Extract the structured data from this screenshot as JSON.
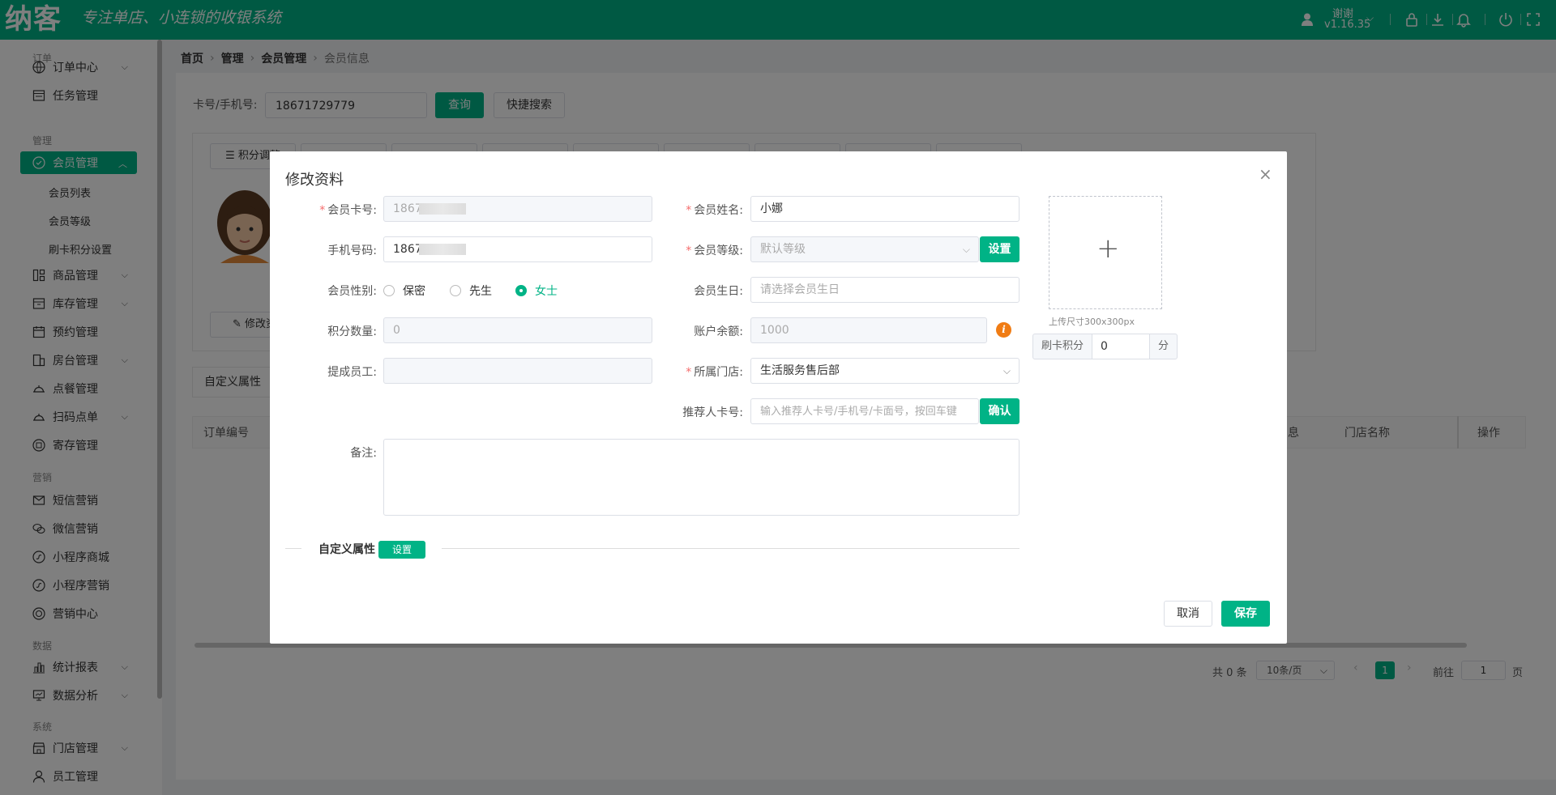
{
  "header": {
    "logo": "纳客",
    "slogan": "专注单店、小连锁的收银系统",
    "user_name": "谢谢",
    "version": "v1.16.35"
  },
  "sidebar": {
    "sections": [
      "订单",
      "管理",
      "营销",
      "数据",
      "系统"
    ],
    "items": [
      {
        "label": "订单中心"
      },
      {
        "label": "任务管理"
      },
      {
        "label": "会员管理"
      },
      {
        "label": "会员列表"
      },
      {
        "label": "会员等级"
      },
      {
        "label": "刷卡积分设置"
      },
      {
        "label": "商品管理"
      },
      {
        "label": "库存管理"
      },
      {
        "label": "预约管理"
      },
      {
        "label": "房台管理"
      },
      {
        "label": "点餐管理"
      },
      {
        "label": "扫码点单"
      },
      {
        "label": "寄存管理"
      },
      {
        "label": "短信营销"
      },
      {
        "label": "微信营销"
      },
      {
        "label": "小程序商城"
      },
      {
        "label": "小程序营销"
      },
      {
        "label": "营销中心"
      },
      {
        "label": "统计报表"
      },
      {
        "label": "数据分析"
      },
      {
        "label": "门店管理"
      },
      {
        "label": "员工管理"
      }
    ]
  },
  "breadcrumb": [
    "首页",
    "管理",
    "会员管理",
    "会员信息"
  ],
  "search": {
    "label": "卡号/手机号:",
    "value": "18671729779",
    "query_btn": "查询",
    "quick_btn": "快捷搜索"
  },
  "page": {
    "tab_first": "积分调整",
    "edit_btn": "修改资",
    "custom_tab": "自定义属性",
    "col_order_no": "订单编号",
    "col_info": "息",
    "col_store": "门店名称",
    "col_op": "操作",
    "pagination": {
      "total": "共 0 条",
      "page_size": "10条/页",
      "current": "1",
      "goto_label": "前往",
      "goto_value": "1",
      "page_unit": "页"
    }
  },
  "dialog": {
    "title": "修改资料",
    "card_no_label": "会员卡号:",
    "card_no_value": "1867",
    "name_label": "会员姓名:",
    "name_value": "小娜",
    "phone_label": "手机号码:",
    "phone_value": "1867",
    "level_label": "会员等级:",
    "level_value": "默认等级",
    "level_set_btn": "设置",
    "gender_label": "会员性别:",
    "gender_options": [
      "保密",
      "先生",
      "女士"
    ],
    "gender_selected": "女士",
    "birthday_label": "会员生日:",
    "birthday_placeholder": "请选择会员生日",
    "points_label": "积分数量:",
    "points_value": "0",
    "balance_label": "账户余额:",
    "balance_value": "1000",
    "staff_label": "提成员工:",
    "store_label": "所属门店:",
    "store_value": "生活服务售后部",
    "referrer_label": "推荐人卡号:",
    "referrer_placeholder": "输入推荐人卡号/手机号/卡面号，按回车键",
    "referrer_btn": "确认",
    "remark_label": "备注:",
    "custom_attr_label": "自定义属性",
    "custom_attr_btn": "设置",
    "upload_hint": "上传尺寸300x300px",
    "swipe_label": "刷卡积分",
    "swipe_value": "0",
    "swipe_unit": "分",
    "cancel_btn": "取消",
    "save_btn": "保存"
  }
}
